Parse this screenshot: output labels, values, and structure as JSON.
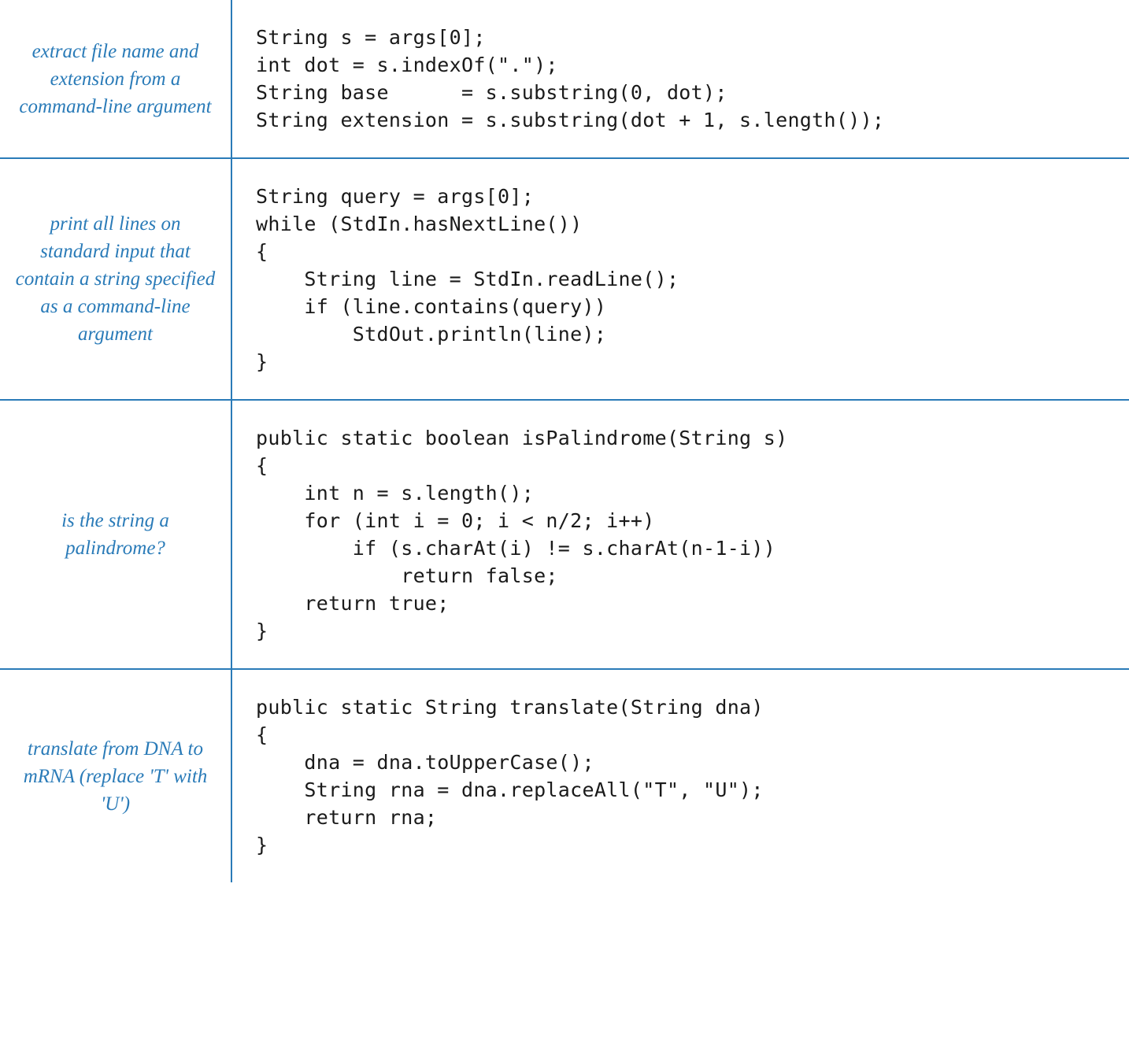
{
  "rows": [
    {
      "description": "extract file name and extension from a command-line argument",
      "code": "String s = args[0];\nint dot = s.indexOf(\".\");\nString base      = s.substring(0, dot);\nString extension = s.substring(dot + 1, s.length());"
    },
    {
      "description": "print all lines on standard input that contain a string specified as a command-line argument",
      "code": "String query = args[0];\nwhile (StdIn.hasNextLine())\n{\n    String line = StdIn.readLine();\n    if (line.contains(query))\n        StdOut.println(line);\n}"
    },
    {
      "description": "is the string a palindrome?",
      "code": "public static boolean isPalindrome(String s)\n{\n    int n = s.length();\n    for (int i = 0; i < n/2; i++)\n        if (s.charAt(i) != s.charAt(n-1-i))\n            return false;\n    return true;\n}"
    },
    {
      "description": "translate from DNA to mRNA (replace 'T' with 'U')",
      "code": "public static String translate(String dna)\n{\n    dna = dna.toUpperCase();\n    String rna = dna.replaceAll(\"T\", \"U\");\n    return rna;\n}"
    }
  ]
}
